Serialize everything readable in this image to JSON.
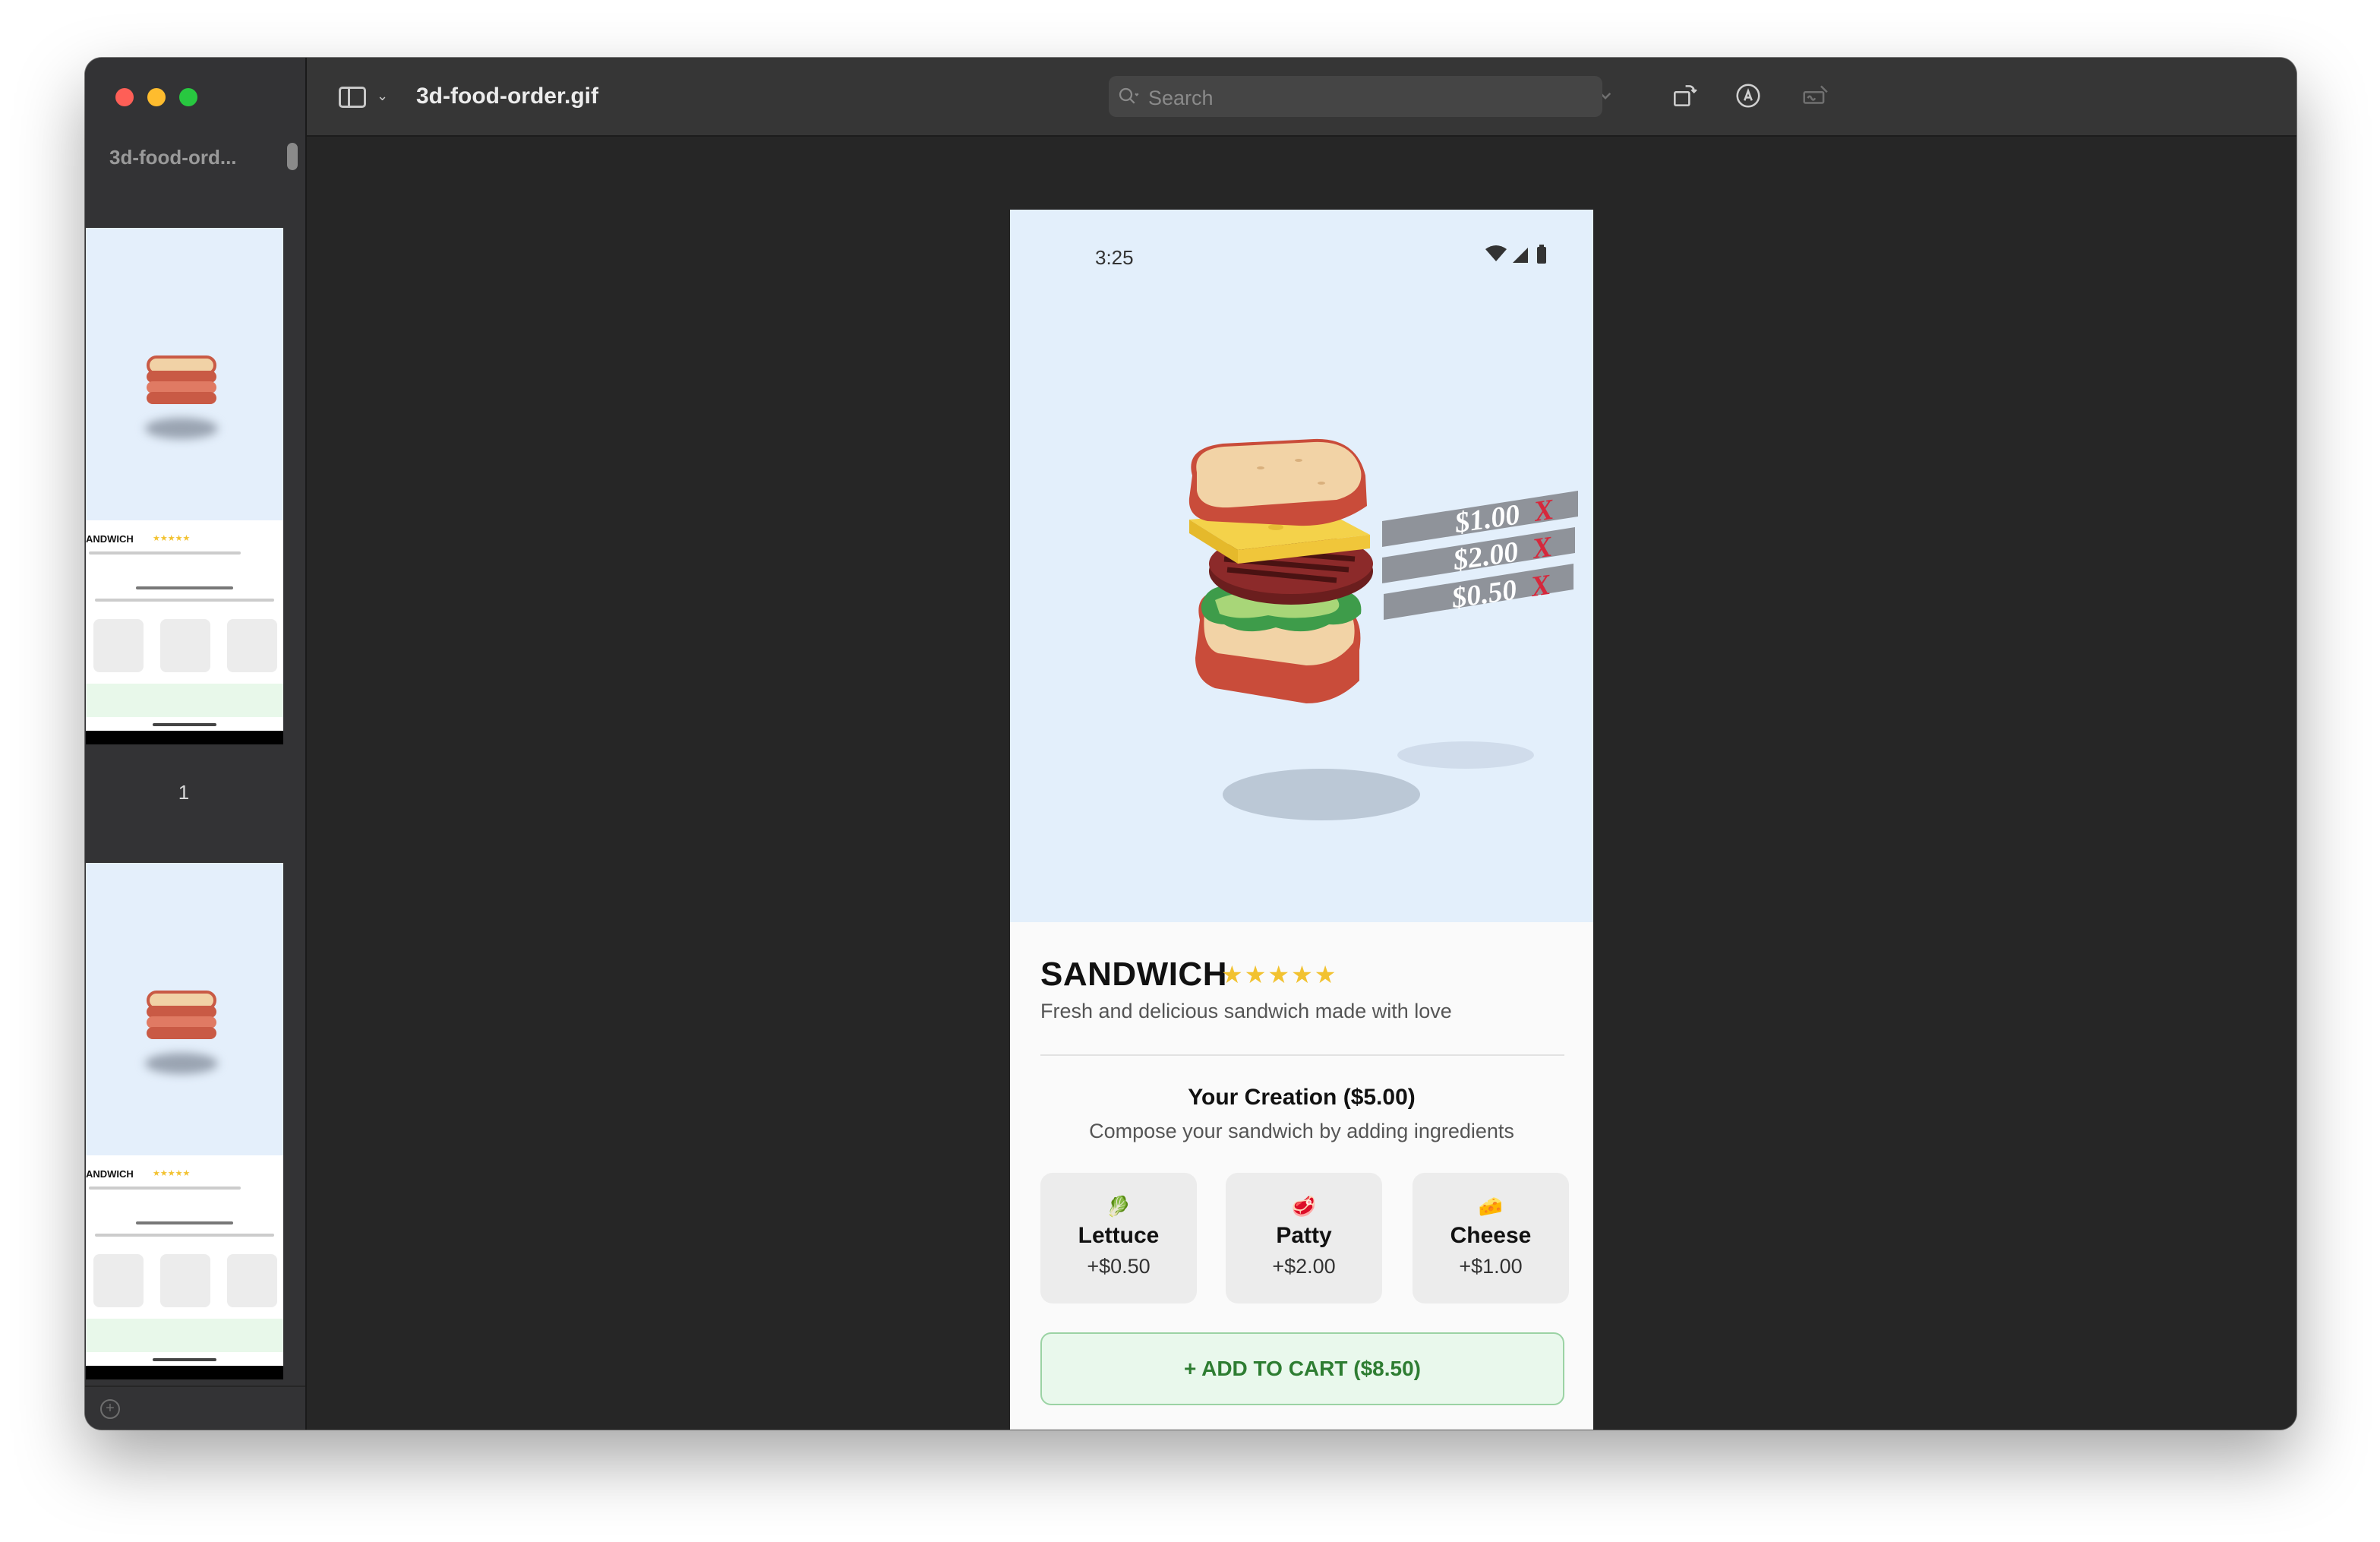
{
  "window": {
    "file_title": "3d-food-order.gif",
    "sidebar_title": "3d-food-ord...",
    "page_number": "1",
    "search_placeholder": "Search"
  },
  "phone": {
    "status_time": "3:25",
    "price_tags": [
      "$1.00",
      "$2.00",
      "$0.50"
    ],
    "price_tag_close": "X",
    "product_name": "SANDWICH",
    "rating_stars": "★★★★★",
    "rating_value": 5,
    "description": "Fresh and delicious sandwich made with love",
    "creation_title": "Your Creation ($5.00)",
    "creation_subtitle": "Compose your sandwich by adding ingredients",
    "ingredients": [
      {
        "icon": "lettuce-icon",
        "emoji": "🥬",
        "name": "Lettuce",
        "price": "+$0.50"
      },
      {
        "icon": "meat-icon",
        "emoji": "🥩",
        "name": "Patty",
        "price": "+$2.00"
      },
      {
        "icon": "cheese-icon",
        "emoji": "🧀",
        "name": "Cheese",
        "price": "+$1.00"
      }
    ],
    "add_to_cart": "+ ADD TO CART ($8.50)"
  },
  "thumbnail": {
    "name": "ANDWICH",
    "stars": "★★★★★"
  },
  "colors": {
    "accent_green": "#2e7d32",
    "hero_bg": "#e3effb",
    "star": "#f2c230",
    "price_x": "#d6283c"
  }
}
